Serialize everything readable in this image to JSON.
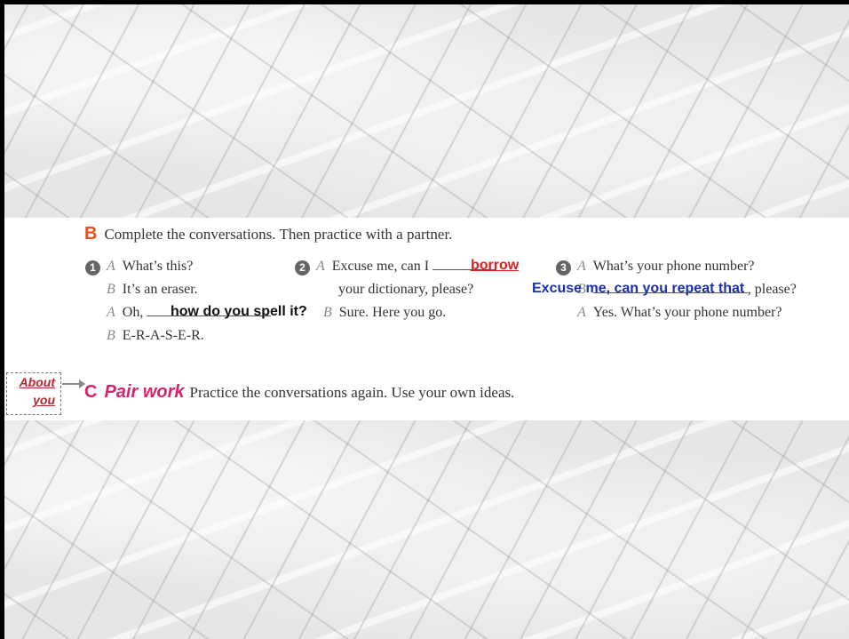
{
  "section_b": {
    "letter": "B",
    "instruction": "Complete the conversations. Then practice with a partner.",
    "conv1": {
      "num": "1",
      "l1_spk": "A",
      "l1": "What’s this?",
      "l2_spk": "B",
      "l2": "It’s an eraser.",
      "l3_spk": "A",
      "l3": "Oh,",
      "l4_spk": "B",
      "l4": "E-R-A-S-E-R.",
      "answer": "how do you spell it?"
    },
    "conv2": {
      "num": "2",
      "l1_spk": "A",
      "l1": "Excuse me, can I",
      "l2": "your dictionary, please?",
      "l3_spk": "B",
      "l3": "Sure. Here you go.",
      "answer": "borrow"
    },
    "conv3": {
      "num": "3",
      "l1_spk": "A",
      "l1": "What’s your phone number?",
      "l2_spk": "B",
      "l2_end": ", please?",
      "l3_spk": "A",
      "l3": "Yes. What’s your phone number?",
      "answer": "Excuse me, can you repeat that"
    }
  },
  "about_you": {
    "line1": "About",
    "line2": "you"
  },
  "section_c": {
    "letter": "C",
    "label": "Pair work",
    "instruction": "Practice the conversations again. Use your own ideas."
  },
  "colors": {
    "letter_b": "#e8501e",
    "pair_work": "#d6246b",
    "answer_red": "#e0201c",
    "answer_blue": "#1a2fb0"
  }
}
